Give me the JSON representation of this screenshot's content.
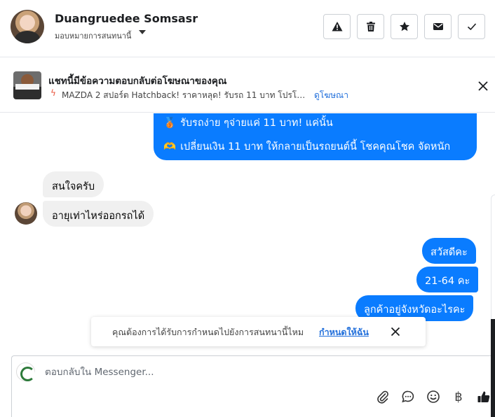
{
  "header": {
    "contact_name": "Duangruedee Somsasr",
    "status_label": "มอบหมายการสนทนานี้",
    "actions": [
      {
        "name": "warning-icon",
        "label": "Report"
      },
      {
        "name": "trash-icon",
        "label": "Delete"
      },
      {
        "name": "star-icon",
        "label": "Star"
      },
      {
        "name": "envelope-icon",
        "label": "Mark unread"
      },
      {
        "name": "checkmark-icon",
        "label": "Done"
      }
    ]
  },
  "ad_banner": {
    "title": "แชทนี้มีข้อความตอบกลับต่อโฆษณาของคุณ",
    "thumb_caption": "รถยนต์",
    "description": "MAZDA 2 สปอร์ต Hatchback! ราคาหลุด! รับรถ 11 บาท โปรโมชั่น 11....",
    "link_label": "ดูโฆษณา",
    "bolt_icon": "lightning-icon"
  },
  "messages": {
    "page_message_lines": [
      {
        "emoji": "🥉",
        "text": "รับรถง่าย ๆจ่ายแค่ 11 บาท! แค่นั้น"
      },
      {
        "emoji": "🫶",
        "text": "เปลี่ยนเงิน 11 บาท ให้กลายเป็นรถยนต์นี้ โชคคุณโชค จัดหนัก"
      }
    ],
    "incoming": [
      "สนใจครับ",
      "อายุเท่าไหร่ออกรถได้"
    ],
    "outgoing": [
      "สวัสดีคะ",
      "21-64 คะ",
      "ลูกค้าอยู่จังหวัดอะไรคะ"
    ]
  },
  "toast": {
    "text": "คุณต้องการได้รับการกำหนดไปยังการสนทนานี้ไหม",
    "link_label": "กำหนดให้ฉัน"
  },
  "composer": {
    "placeholder": "ตอบกลับใน Messenger...",
    "tools": [
      "paperclip-icon",
      "chat-bubble-icon",
      "smiley-icon",
      "baht-icon",
      "thumbs-up-icon"
    ],
    "baht_symbol": "฿"
  },
  "colors": {
    "accent": "#0a7cff",
    "link": "#216fdb",
    "incoming_bubble": "#f0f0f0",
    "border": "#ccd0d5"
  }
}
